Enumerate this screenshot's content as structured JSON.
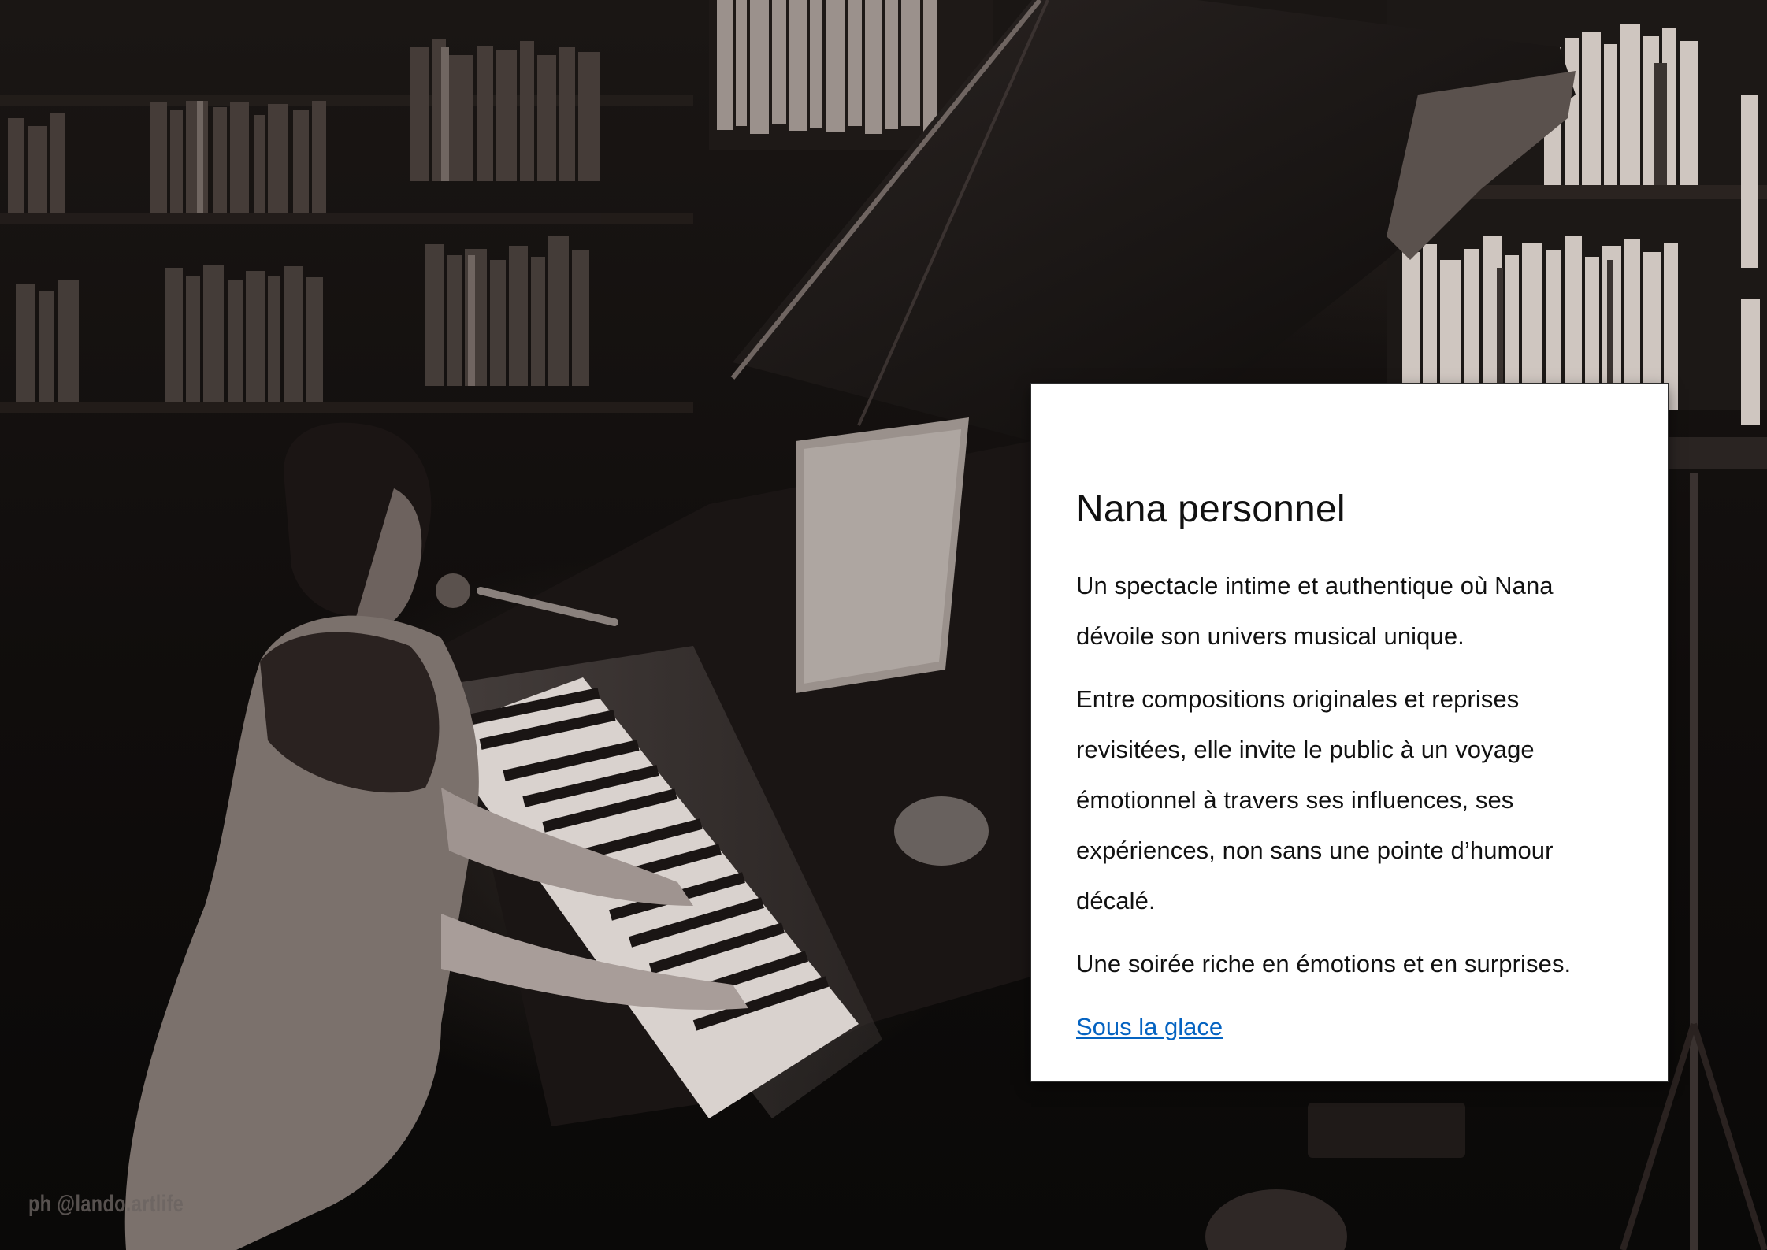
{
  "photo": {
    "watermark": "ph @lando.artlife"
  },
  "card": {
    "title": "Nana personnel",
    "paragraphs": [
      "Un spectacle intime et authentique où Nana dévoile son univers musical unique.",
      "Entre compositions originales et reprises revisitées, elle invite le public à un voyage émotionnel à travers ses influences, ses expériences,  non sans une pointe d’humour décalé.",
      "Une soirée riche en émotions et en surprises."
    ],
    "link_label": "Sous la glace"
  },
  "colors": {
    "card_background": "#ffffff",
    "link": "#0563c1",
    "text": "#111111"
  }
}
